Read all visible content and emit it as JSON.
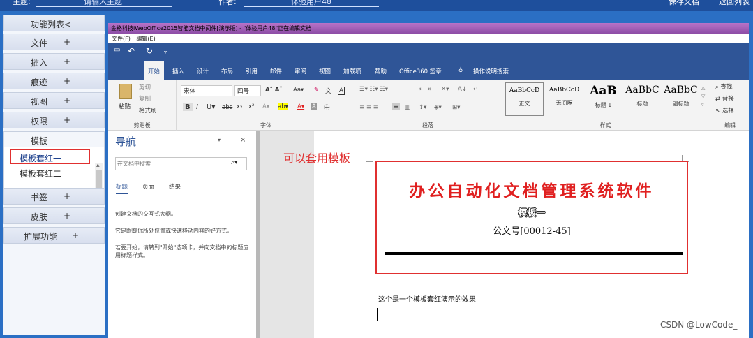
{
  "topbar": {
    "subject_label": "主题:",
    "subject_value": "请输入主题",
    "author_label": "作者:",
    "author_value": "体验用户48",
    "save_button": "保存文档",
    "back_button": "返回列表"
  },
  "sidebar": {
    "items": [
      {
        "label": "功能列表<",
        "mark": ""
      },
      {
        "label": "文件",
        "mark": "+"
      },
      {
        "label": "插入",
        "mark": "+"
      },
      {
        "label": "痕迹",
        "mark": "+"
      },
      {
        "label": "视图",
        "mark": "+"
      },
      {
        "label": "权限",
        "mark": "+"
      },
      {
        "label": "模板",
        "mark": "-"
      }
    ],
    "template_sub": [
      {
        "label": "模板套红一",
        "selected": true
      },
      {
        "label": "模板套红二",
        "selected": false
      }
    ],
    "items_after": [
      {
        "label": "书签",
        "mark": "+"
      },
      {
        "label": "皮肤",
        "mark": "+"
      },
      {
        "label": "扩展功能",
        "mark": "+"
      }
    ]
  },
  "office": {
    "window_title": "金格科技iWebOffice2015智能文档中间件[演示版] - \"体验用户48\"正在编辑文档",
    "menu": [
      "文件(F)",
      "编辑(E)"
    ],
    "tabs": [
      "开始",
      "插入",
      "设计",
      "布局",
      "引用",
      "邮件",
      "审阅",
      "视图",
      "加载项",
      "帮助",
      "Office360 签章",
      "操作说明搜索"
    ],
    "active_tab": "开始",
    "clipboard": {
      "paste": "粘贴",
      "cut": "剪切",
      "copy": "复制",
      "format_painter": "格式刷",
      "group": "剪贴板"
    },
    "font": {
      "family": "宋体",
      "size": "四号",
      "group": "字体"
    },
    "paragraph": {
      "group": "段落"
    },
    "styles": {
      "items": [
        {
          "preview": "AaBbCcD",
          "name": "正文"
        },
        {
          "preview": "AaBbCcD",
          "name": "无间隔"
        },
        {
          "preview": "AaB",
          "name": "标题 1"
        },
        {
          "preview": "AaBbC",
          "name": "标题"
        },
        {
          "preview": "AaBbC",
          "name": "副标题"
        }
      ],
      "group": "样式"
    },
    "editing": {
      "find": "查找",
      "replace": "替换",
      "select": "选择",
      "group": "编辑"
    }
  },
  "nav": {
    "title": "导航",
    "search_placeholder": "在文档中搜索",
    "tabs": [
      "标题",
      "页面",
      "结果"
    ],
    "msg1": "创建文档的交互式大纲。",
    "msg2": "它是跟踪你所处位置或快速移动内容的好方式。",
    "msg3": "若要开始，请转到\"开始\"选项卡，并向文档中的标题应用标题样式。"
  },
  "doc": {
    "annotation": "可以套用模板",
    "title": "办公自动化文档管理系统软件",
    "mark": "模板一",
    "number": "公文号[00012-45]",
    "body": "这个是一个模板套红演示的效果"
  },
  "watermark": "CSDN @LowCode_",
  "colors": {
    "accent": "#2f5597",
    "red": "#e03030",
    "title_bar": "#8d4da6"
  }
}
